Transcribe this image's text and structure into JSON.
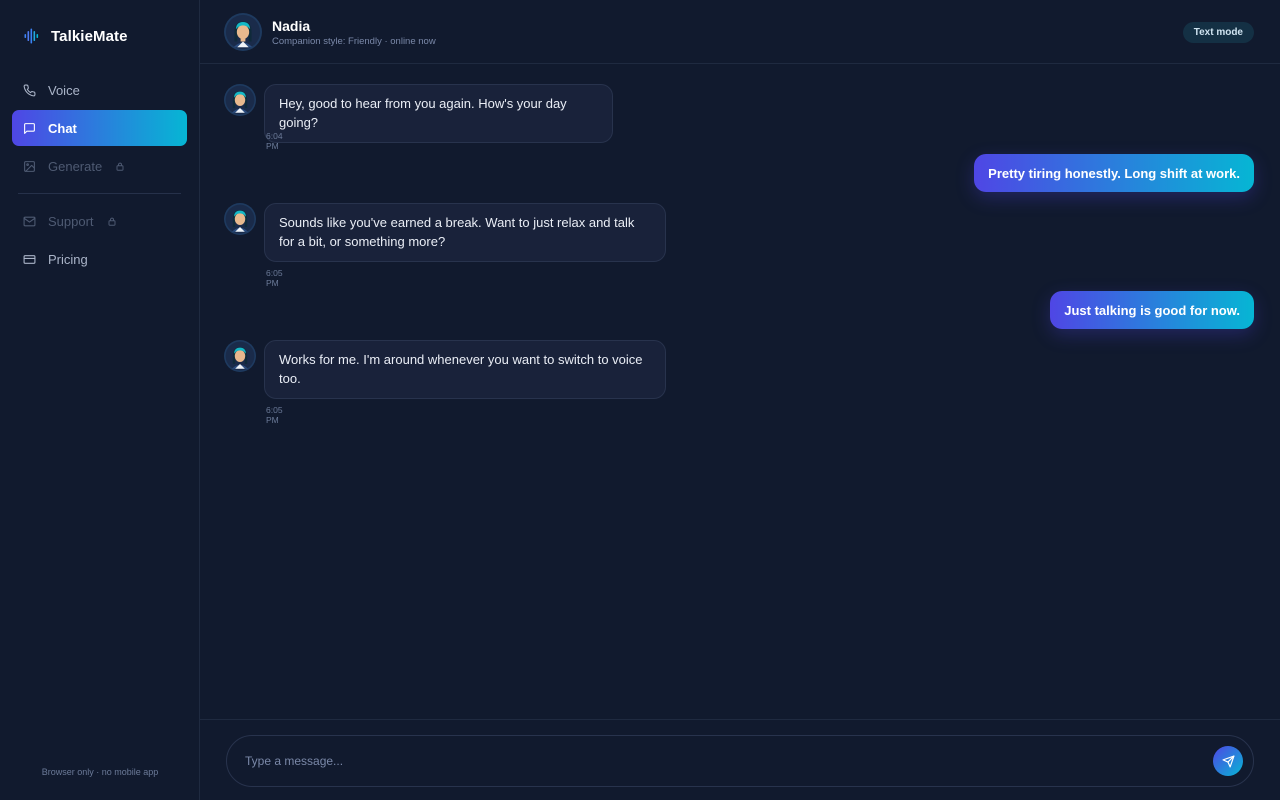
{
  "app": {
    "name": "TalkieMate",
    "logo_icon": "audio-bars-icon"
  },
  "nav": {
    "items": [
      {
        "label": "Voice",
        "icon": "phone-icon",
        "state": "default"
      },
      {
        "label": "Chat",
        "icon": "chat-bubble-icon",
        "state": "active"
      },
      {
        "label": "Generate",
        "icon": "image-icon",
        "state": "locked"
      },
      {
        "label": "Support",
        "icon": "mail-icon",
        "state": "locked"
      },
      {
        "label": "Pricing",
        "icon": "credit-card-icon",
        "state": "default"
      }
    ],
    "footer": "Browser only · no mobile app"
  },
  "header": {
    "name": "Nadia",
    "subtitle": "Companion style: Friendly · online now",
    "mode": "Text mode"
  },
  "messages": [
    {
      "from": "bot",
      "text": "Hey, good to hear from you again. How's your day going?",
      "time": "6:04 PM"
    },
    {
      "from": "user",
      "text": "Pretty tiring honestly. Long shift at work."
    },
    {
      "from": "bot",
      "text": "Sounds like you've earned a break. Want to just relax and talk for a bit, or something more?",
      "time": "6:05 PM"
    },
    {
      "from": "user",
      "text": "Just talking is good for now."
    },
    {
      "from": "bot",
      "text": "Works for me. I'm around whenever you want to switch to voice too.",
      "time": "6:05 PM"
    }
  ],
  "composer": {
    "placeholder": "Type a message...",
    "send_icon": "send-icon"
  },
  "colors": {
    "background": "#111a2e",
    "accent_start": "#4f46e5",
    "accent_end": "#06b6d4",
    "bot_bubble": "#19223a"
  }
}
